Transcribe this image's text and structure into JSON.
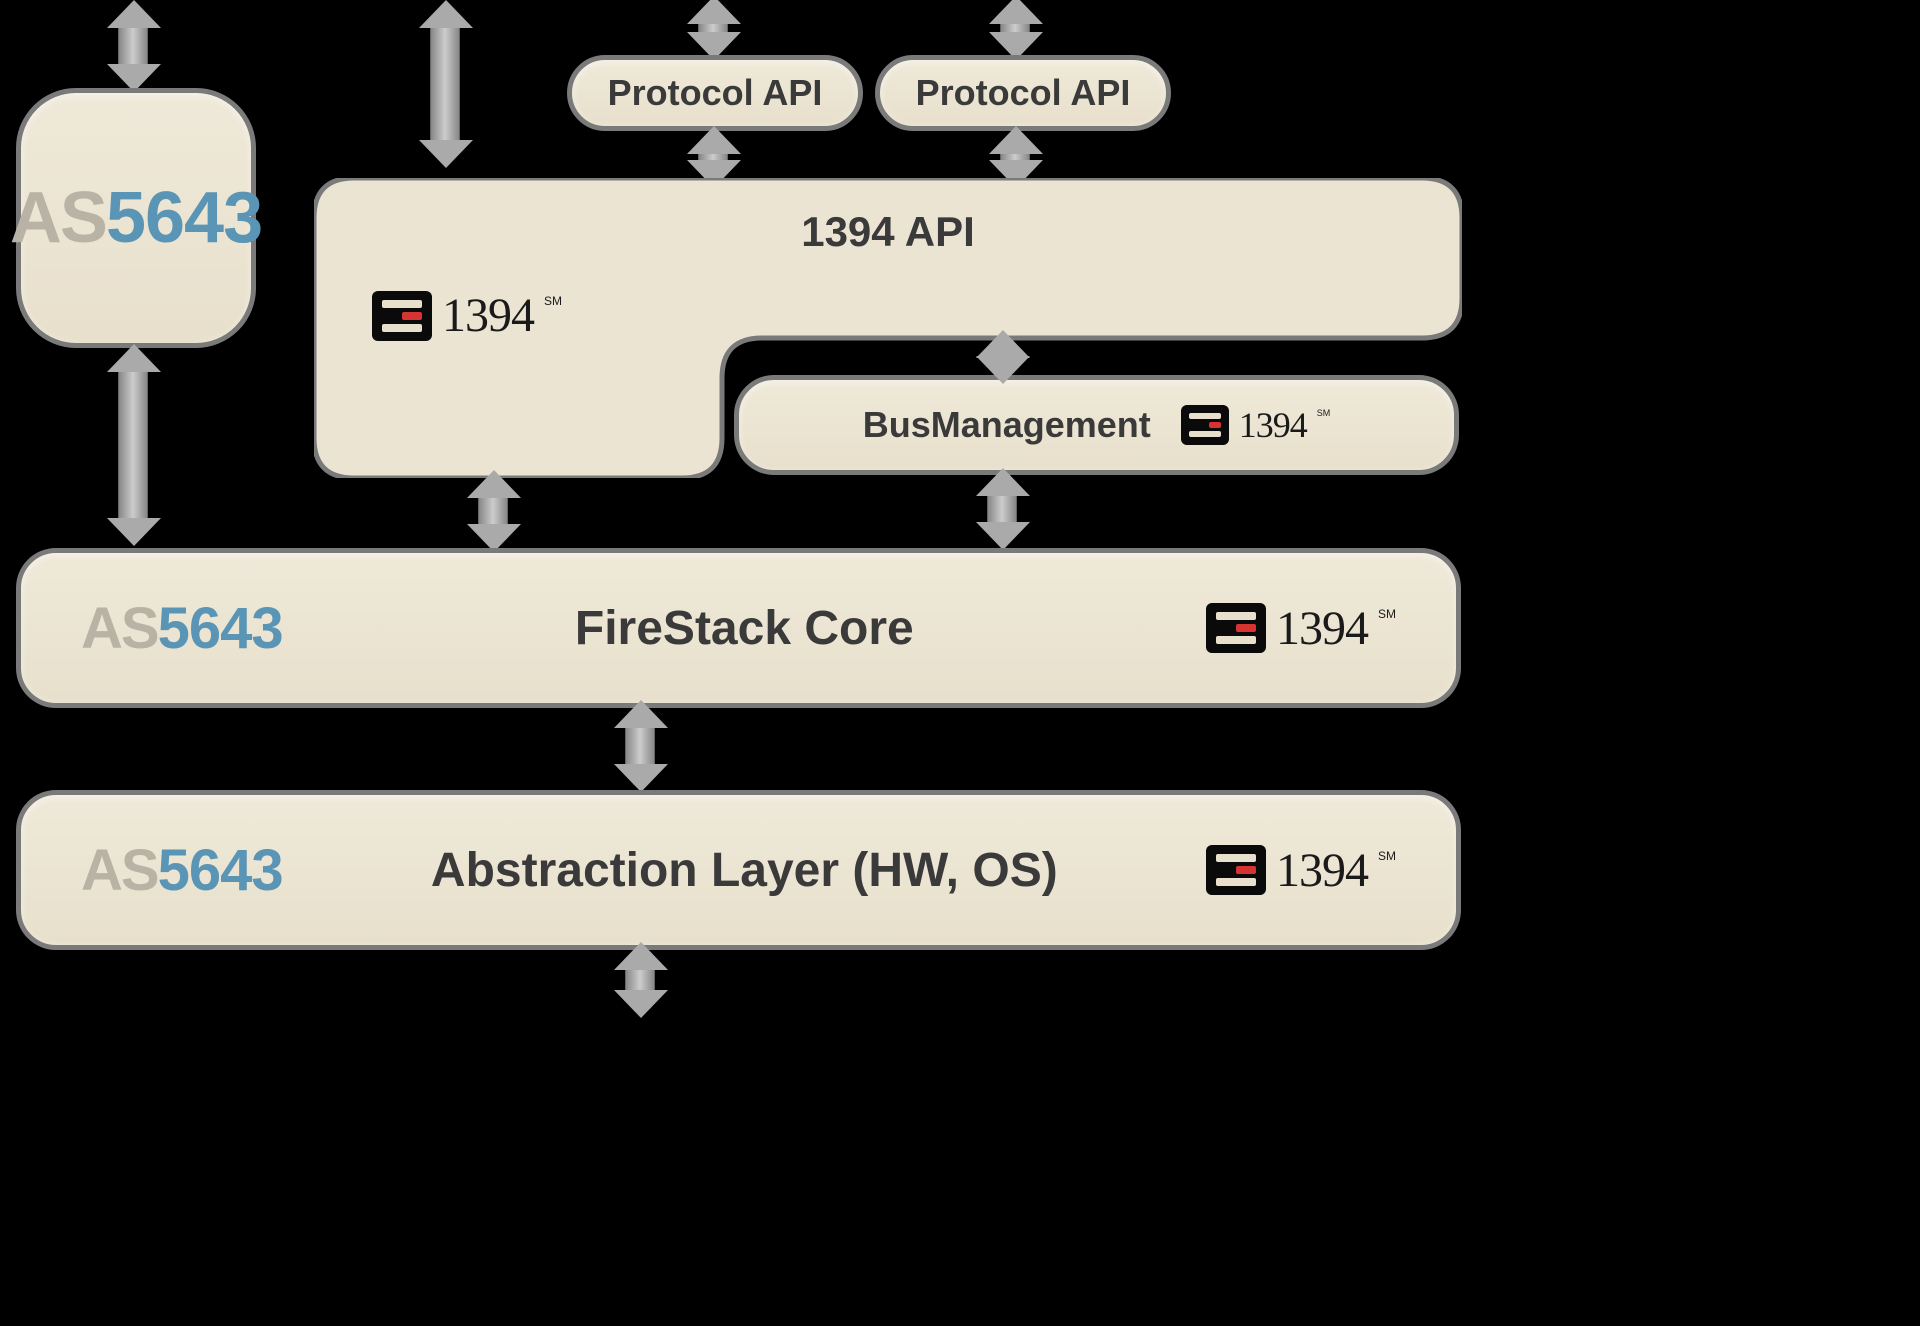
{
  "protocol_api_1": {
    "label": "Protocol API"
  },
  "protocol_api_2": {
    "label": "Protocol API"
  },
  "as5643_box": {
    "logo_prefix": "AS",
    "logo_number": "5643"
  },
  "api_1394": {
    "label": "1394 API",
    "ieee_num": "1394",
    "ieee_sm": "SM"
  },
  "bus_mgmt": {
    "label": "BusManagement",
    "ieee_num": "1394",
    "ieee_sm": "SM"
  },
  "firestack_core": {
    "label": "FireStack Core",
    "logo_prefix": "AS",
    "logo_number": "5643",
    "ieee_num": "1394",
    "ieee_sm": "SM"
  },
  "abstraction_layer": {
    "label": "Abstraction Layer (HW, OS)",
    "logo_prefix": "AS",
    "logo_number": "5643",
    "ieee_num": "1394",
    "ieee_sm": "SM"
  }
}
